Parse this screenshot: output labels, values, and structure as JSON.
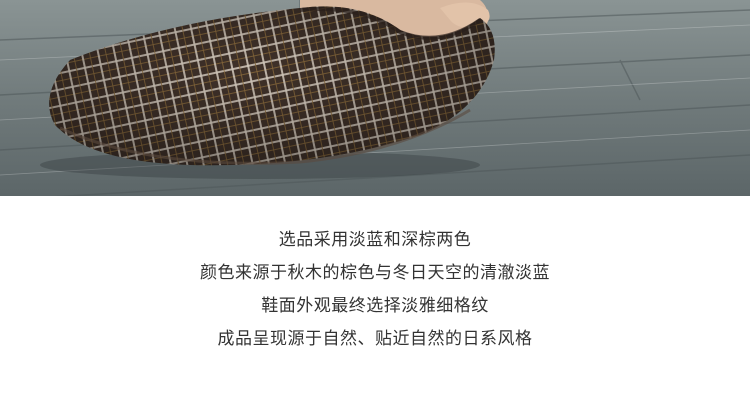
{
  "caption": {
    "lines": [
      "选品采用淡蓝和深棕两色",
      "颜色来源于秋木的棕色与冬日天空的清澈淡蓝",
      "鞋面外观最终选择淡雅细格纹",
      "成品呈现源于自然、贴近自然的日系风格"
    ]
  },
  "colors": {
    "floor": "#6f7a7c",
    "slipper_base": "#3f3129",
    "plaid_light": "#d6ccbf",
    "plaid_accent": "#8a6a3c",
    "text": "#333333"
  }
}
